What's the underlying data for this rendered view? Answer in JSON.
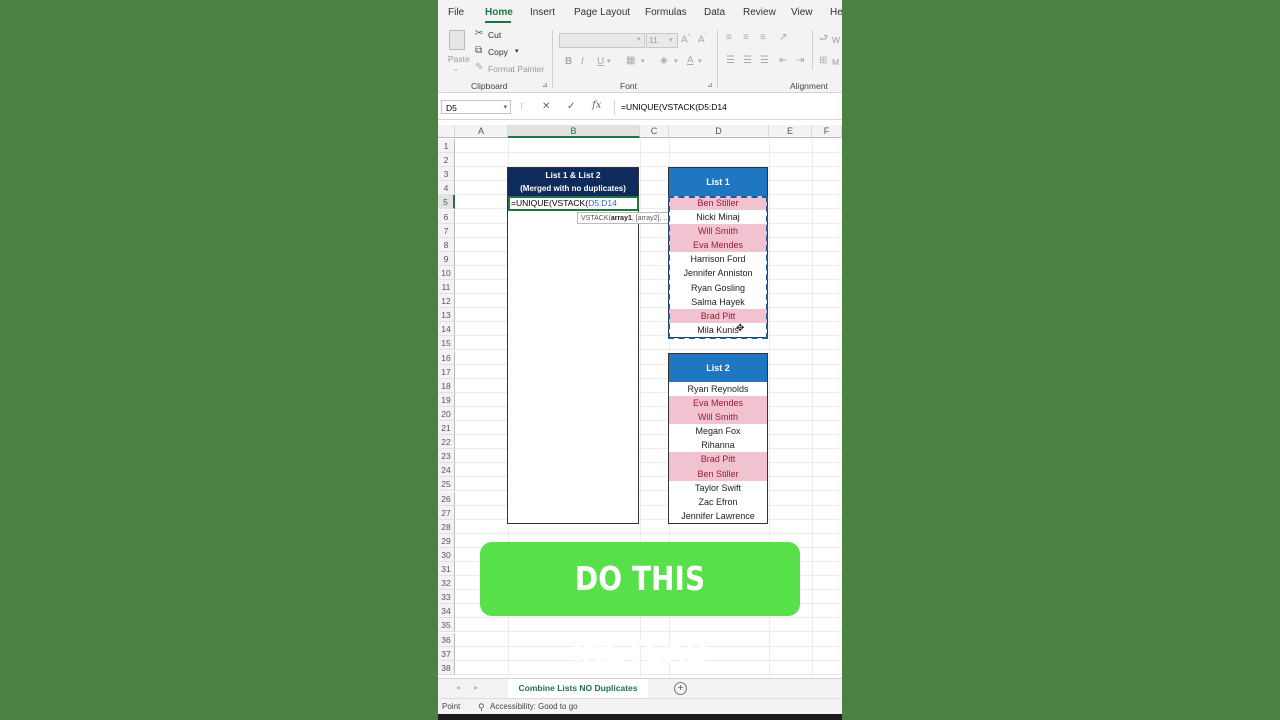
{
  "ribbon": {
    "tabs": [
      "File",
      "Home",
      "Insert",
      "Page Layout",
      "Formulas",
      "Data",
      "Review",
      "View",
      "He"
    ],
    "active_tab": "Home",
    "clipboard": {
      "paste": "Paste",
      "cut": "Cut",
      "copy": "Copy",
      "format_painter": "Format Painter",
      "group_label": "Clipboard"
    },
    "font": {
      "font_size": "11",
      "bold": "B",
      "italic": "I",
      "underline": "U",
      "group_label": "Font"
    },
    "alignment": {
      "group_label": "Alignment",
      "wrap": "W",
      "merge": "M"
    }
  },
  "formula_bar": {
    "name_box": "D5",
    "formula": "=UNIQUE(VSTACK(D5:D14"
  },
  "grid": {
    "columns": [
      "A",
      "B",
      "C",
      "D",
      "E",
      "F"
    ],
    "rows": [
      "1",
      "2",
      "3",
      "4",
      "5",
      "6",
      "7",
      "8",
      "9",
      "10",
      "11",
      "12",
      "13",
      "14",
      "15",
      "16",
      "17",
      "18",
      "19",
      "20",
      "21",
      "22",
      "23",
      "24",
      "25",
      "26",
      "27",
      "28",
      "29",
      "30",
      "31",
      "32",
      "33",
      "34",
      "35",
      "36",
      "37",
      "38"
    ],
    "selected_column": "B",
    "selected_row": "5"
  },
  "merged_table": {
    "title_line1": "List 1 & List 2",
    "title_line2": "(Merged with no duplicates)"
  },
  "edit_cell": {
    "formula_prefix": "=UNIQUE(VSTACK(",
    "formula_ref": "D5:D14"
  },
  "tooltip": {
    "fn": "VSTACK(",
    "arg1": "array1",
    "rest": ", [array2], ...)"
  },
  "list1": {
    "header": "List 1",
    "items": [
      "Ben Stiller",
      "Nicki Minaj",
      "Will Smith",
      "Eva Mendes",
      "Harrison Ford",
      "Jennifer Anniston",
      "Ryan Gosling",
      "Salma Hayek",
      "Brad Pitt",
      "Mila Kunis"
    ],
    "duplicates": [
      true,
      false,
      true,
      true,
      false,
      false,
      false,
      false,
      true,
      false
    ]
  },
  "list2": {
    "header": "List 2",
    "items": [
      "Ryan Reynolds",
      "Eva Mendes",
      "Will Smith",
      "Megan Fox",
      "Rihanna",
      "Brad Pitt",
      "Ben Stiller",
      "Taylor Swift",
      "Zac Efron",
      "Jennifer Lawrence"
    ],
    "duplicates": [
      false,
      true,
      true,
      false,
      false,
      true,
      true,
      false,
      false,
      false
    ]
  },
  "cta": {
    "text": "DO THIS INSTEAD"
  },
  "sheet": {
    "tab_name": "Combine Lists NO Duplicates",
    "add_sheet": "+"
  },
  "status": {
    "mode": "Point",
    "accessibility": "Accessibility: Good to go"
  },
  "colors": {
    "excel_green": "#217346",
    "dup_fill": "#f1c3d0",
    "dup_text": "#9c1a3a",
    "list_header": "#1f76c1",
    "merged_header": "#0f2b5b",
    "cta": "#58e04a",
    "background": "#4b8244"
  }
}
